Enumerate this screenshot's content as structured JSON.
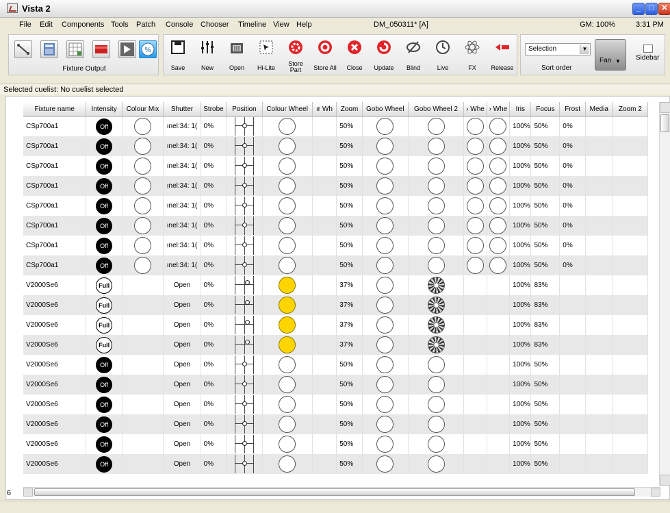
{
  "window": {
    "title": "Vista 2"
  },
  "menu": [
    "File",
    "Edit",
    "Components",
    "Tools",
    "Patch",
    "Console",
    "Chooser",
    "Timeline",
    "View",
    "Help"
  ],
  "menu_right": {
    "document": "DM_050311* [A]",
    "gm": "GM: 100%",
    "clock": "3:31 PM"
  },
  "toolbar": {
    "group_label": "Fixture Output",
    "buttons": {
      "save": "Save",
      "new": "New",
      "open": "Open",
      "hilite": "Hi-Lite",
      "store_part": "Store Part",
      "store_all": "Store All",
      "close": "Close",
      "update": "Update",
      "blind": "Blind",
      "live": "Live",
      "fx": "FX",
      "release": "Release"
    },
    "sort_select_value": "Selection",
    "sort_label": "Sort order",
    "fan_label": "Fan",
    "sidebar_label": "Sidebar"
  },
  "status": "Selected cuelist: No cuelist selected",
  "side_number": "6",
  "table": {
    "columns": [
      "Fixture name",
      "Intensity",
      "Colour Mix",
      "Shutter",
      "Strobe",
      "Position",
      "Colour Wheel",
      "ır Wh",
      "Zoom",
      "Gobo Wheel",
      "Gobo Wheel 2",
      "› Whe",
      "› Whe",
      "Iris",
      "Focus",
      "Frost",
      "Media",
      "Zoom 2"
    ],
    "rows": [
      {
        "name": "CSp700a1",
        "intensity": "Off",
        "shutter": "ınel:34: 1(",
        "strobe": "0%",
        "zoom": "50%",
        "iris": "100%",
        "focus": "50%",
        "frost": "0%"
      },
      {
        "name": "CSp700a1",
        "intensity": "Off",
        "shutter": "ınel:34: 1(",
        "strobe": "0%",
        "zoom": "50%",
        "iris": "100%",
        "focus": "50%",
        "frost": "0%"
      },
      {
        "name": "CSp700a1",
        "intensity": "Off",
        "shutter": "ınel:34: 1(",
        "strobe": "0%",
        "zoom": "50%",
        "iris": "100%",
        "focus": "50%",
        "frost": "0%"
      },
      {
        "name": "CSp700a1",
        "intensity": "Off",
        "shutter": "ınel:34: 1(",
        "strobe": "0%",
        "zoom": "50%",
        "iris": "100%",
        "focus": "50%",
        "frost": "0%"
      },
      {
        "name": "CSp700a1",
        "intensity": "Off",
        "shutter": "ınel:34: 1(",
        "strobe": "0%",
        "zoom": "50%",
        "iris": "100%",
        "focus": "50%",
        "frost": "0%"
      },
      {
        "name": "CSp700a1",
        "intensity": "Off",
        "shutter": "ınel:34: 1(",
        "strobe": "0%",
        "zoom": "50%",
        "iris": "100%",
        "focus": "50%",
        "frost": "0%"
      },
      {
        "name": "CSp700a1",
        "intensity": "Off",
        "shutter": "ınel:34: 1(",
        "strobe": "0%",
        "zoom": "50%",
        "iris": "100%",
        "focus": "50%",
        "frost": "0%"
      },
      {
        "name": "CSp700a1",
        "intensity": "Off",
        "shutter": "ınel:34: 1(",
        "strobe": "0%",
        "zoom": "50%",
        "iris": "100%",
        "focus": "50%",
        "frost": "0%"
      },
      {
        "name": "V2000Se6",
        "intensity": "Full",
        "shutter": "Open",
        "strobe": "0%",
        "zoom": "37%",
        "iris": "100%",
        "focus": "83%",
        "frost": ""
      },
      {
        "name": "V2000Se6",
        "intensity": "Full",
        "shutter": "Open",
        "strobe": "0%",
        "zoom": "37%",
        "iris": "100%",
        "focus": "83%",
        "frost": ""
      },
      {
        "name": "V2000Se6",
        "intensity": "Full",
        "shutter": "Open",
        "strobe": "0%",
        "zoom": "37%",
        "iris": "100%",
        "focus": "83%",
        "frost": ""
      },
      {
        "name": "V2000Se6",
        "intensity": "Full",
        "shutter": "Open",
        "strobe": "0%",
        "zoom": "37%",
        "iris": "100%",
        "focus": "83%",
        "frost": ""
      },
      {
        "name": "V2000Se6",
        "intensity": "Off",
        "shutter": "Open",
        "strobe": "0%",
        "zoom": "50%",
        "iris": "100%",
        "focus": "50%",
        "frost": ""
      },
      {
        "name": "V2000Se6",
        "intensity": "Off",
        "shutter": "Open",
        "strobe": "0%",
        "zoom": "50%",
        "iris": "100%",
        "focus": "50%",
        "frost": ""
      },
      {
        "name": "V2000Se6",
        "intensity": "Off",
        "shutter": "Open",
        "strobe": "0%",
        "zoom": "50%",
        "iris": "100%",
        "focus": "50%",
        "frost": ""
      },
      {
        "name": "V2000Se6",
        "intensity": "Off",
        "shutter": "Open",
        "strobe": "0%",
        "zoom": "50%",
        "iris": "100%",
        "focus": "50%",
        "frost": ""
      },
      {
        "name": "V2000Se6",
        "intensity": "Off",
        "shutter": "Open",
        "strobe": "0%",
        "zoom": "50%",
        "iris": "100%",
        "focus": "50%",
        "frost": ""
      },
      {
        "name": "V2000Se6",
        "intensity": "Off",
        "shutter": "Open",
        "strobe": "0%",
        "zoom": "50%",
        "iris": "100%",
        "focus": "50%",
        "frost": ""
      }
    ]
  },
  "colors": {
    "yellow_wheel": "#ffd500",
    "row_alt": "#e8e8e8"
  }
}
